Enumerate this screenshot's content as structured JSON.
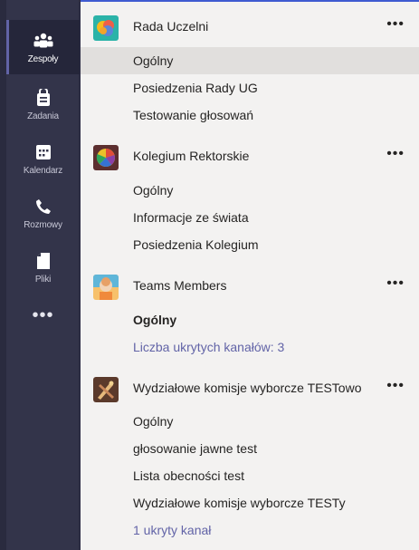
{
  "rail": {
    "items": [
      {
        "label": "Zespoły",
        "icon": "teams-icon",
        "active": true
      },
      {
        "label": "Zadania",
        "icon": "assignments-icon",
        "active": false
      },
      {
        "label": "Kalendarz",
        "icon": "calendar-icon",
        "active": false
      },
      {
        "label": "Rozmowy",
        "icon": "calls-icon",
        "active": false
      },
      {
        "label": "Pliki",
        "icon": "files-icon",
        "active": false
      }
    ],
    "more_label": "•••"
  },
  "teams": [
    {
      "name": "Rada Uczelni",
      "more": "•••",
      "avatar": "rada-avatar-icon",
      "channels": [
        {
          "label": "Ogólny",
          "selected": true
        },
        {
          "label": "Posiedzenia Rady UG"
        },
        {
          "label": "Testowanie głosowań"
        }
      ]
    },
    {
      "name": "Kolegium Rektorskie",
      "more": "•••",
      "avatar": "kolegium-avatar-icon",
      "channels": [
        {
          "label": "Ogólny"
        },
        {
          "label": "Informacje ze świata"
        },
        {
          "label": "Posiedzenia Kolegium"
        }
      ]
    },
    {
      "name": "Teams Members",
      "more": "•••",
      "avatar": "teams-members-avatar-icon",
      "channels": [
        {
          "label": "Ogólny",
          "bold": true
        },
        {
          "label": "Liczba ukrytych kanałów: 3",
          "link": true
        }
      ]
    },
    {
      "name": "Wydziałowe komisje wyborcze TESTowo",
      "more": "•••",
      "avatar": "wydzialowe-avatar-icon",
      "channels": [
        {
          "label": "Ogólny"
        },
        {
          "label": "głosowanie jawne test"
        },
        {
          "label": "Lista obecności test"
        },
        {
          "label": "Wydziałowe komisje wyborcze TESTy"
        },
        {
          "label": "1 ukryty kanał",
          "link": true
        }
      ]
    }
  ],
  "colors": {
    "rail_bg": "#33344a",
    "accent": "#6264a7",
    "panel_bg": "#f3f2f1",
    "selected_bg": "#e1dfdd",
    "top_border": "#3f5bd1"
  }
}
